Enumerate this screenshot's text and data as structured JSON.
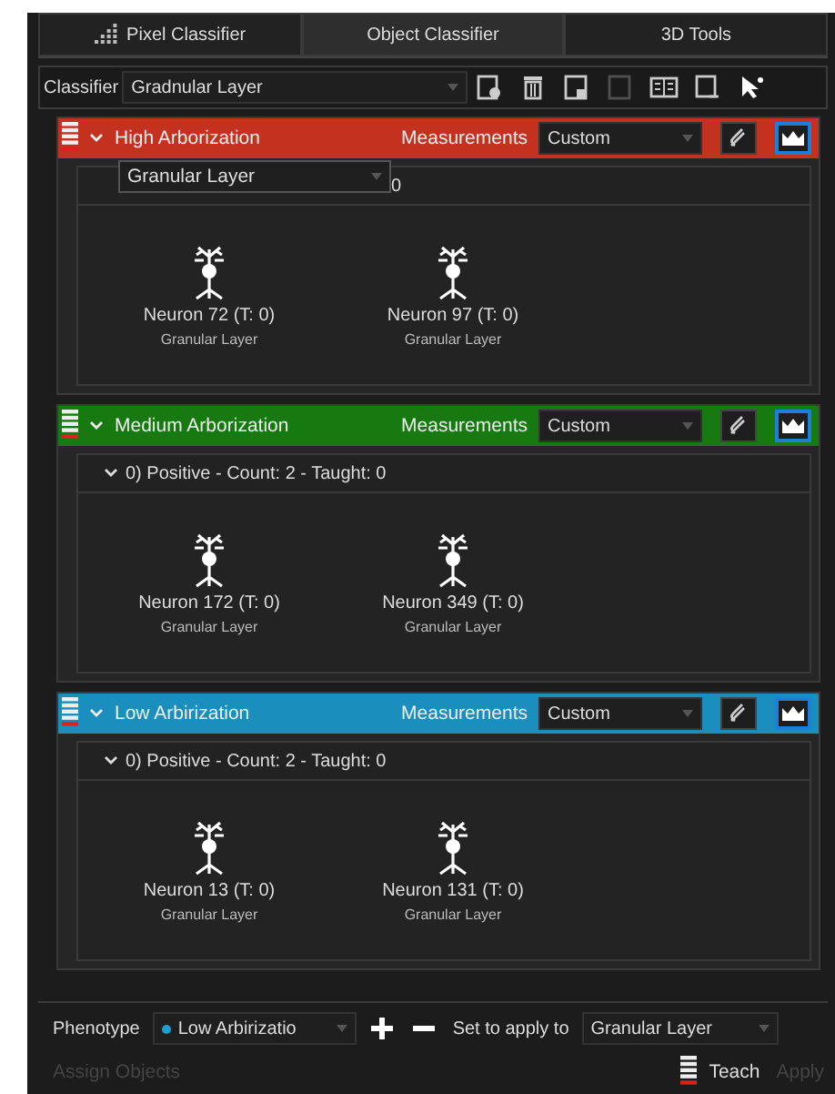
{
  "tabs": [
    {
      "label": "Pixel Classifier",
      "selected": false,
      "icon": true
    },
    {
      "label": "Object Classifier",
      "selected": true
    },
    {
      "label": "3D Tools",
      "selected": false
    }
  ],
  "toolbar": {
    "label": "Classifier",
    "value": "Gradnular Layer",
    "tools": [
      {
        "kind": "add",
        "disabled": false
      },
      {
        "kind": "delete",
        "disabled": false
      },
      {
        "kind": "load",
        "disabled": false
      },
      {
        "kind": "save",
        "disabled": true
      },
      {
        "kind": "compare",
        "disabled": false
      },
      {
        "kind": "export",
        "disabled": false
      },
      {
        "kind": "pointer",
        "disabled": false
      }
    ]
  },
  "groups": [
    {
      "name": "High Arborization",
      "color": "#c4321f",
      "measurements_label": "Measurements",
      "measurements": "Custom",
      "popup": "Granular Layer",
      "subheader": "0",
      "cells": [
        {
          "title": "Neuron 72 (T: 0)",
          "layer": "Granular Layer"
        },
        {
          "title": "Neuron 97 (T: 0)",
          "layer": "Granular Layer"
        }
      ]
    },
    {
      "name": "Medium Arborization",
      "color": "#167a10",
      "measurements_label": "Measurements",
      "measurements": "Custom",
      "subheader": "0) Positive - Count: 2 - Taught: 0",
      "cells": [
        {
          "title": "Neuron 172 (T: 0)",
          "layer": "Granular Layer"
        },
        {
          "title": "Neuron 349 (T: 0)",
          "layer": "Granular Layer"
        }
      ]
    },
    {
      "name": "Low Arbirization",
      "color": "#1a8fbd",
      "measurements_label": "Measurements",
      "measurements": "Custom",
      "subheader": "0) Positive - Count: 2 - Taught: 0",
      "cells": [
        {
          "title": "Neuron 13 (T: 0)",
          "layer": "Granular Layer"
        },
        {
          "title": "Neuron 131 (T: 0)",
          "layer": "Granular Layer"
        }
      ]
    }
  ],
  "bottom": {
    "phenotype_label": "Phenotype",
    "phenotype": {
      "text": "Low Arbirizatio",
      "color": "#1a9fd0"
    },
    "apply_label": "Set to apply to",
    "apply_value": "Granular Layer",
    "assign": "Assign Objects",
    "assign_disabled": true,
    "teach": "Teach",
    "apply": "Apply",
    "apply_disabled": true
  }
}
